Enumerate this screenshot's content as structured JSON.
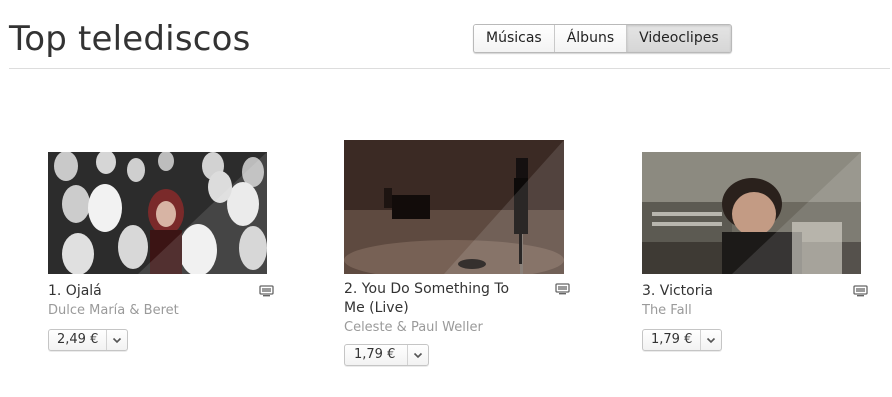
{
  "page": {
    "title": "Top telediscos"
  },
  "tabs": [
    {
      "label": "Músicas",
      "active": false
    },
    {
      "label": "Álbuns",
      "active": false
    },
    {
      "label": "Videoclipes",
      "active": true
    }
  ],
  "videos": [
    {
      "rank_title": "1. Ojalá",
      "artist": "Dulce María & Beret",
      "price": "2,49 €",
      "media_icon": "tv-icon"
    },
    {
      "rank_title": "2. You Do Something To Me (Live)",
      "artist": "Celeste & Paul Weller",
      "price": "1,79 €",
      "media_icon": "tv-icon"
    },
    {
      "rank_title": "3. Victoria",
      "artist": "The Fall",
      "price": "1,79 €",
      "media_icon": "tv-icon"
    }
  ],
  "colors": {
    "active_tab": "#d9d9d9",
    "artist_text": "#9a9a9a",
    "divider": "#dddddd"
  }
}
